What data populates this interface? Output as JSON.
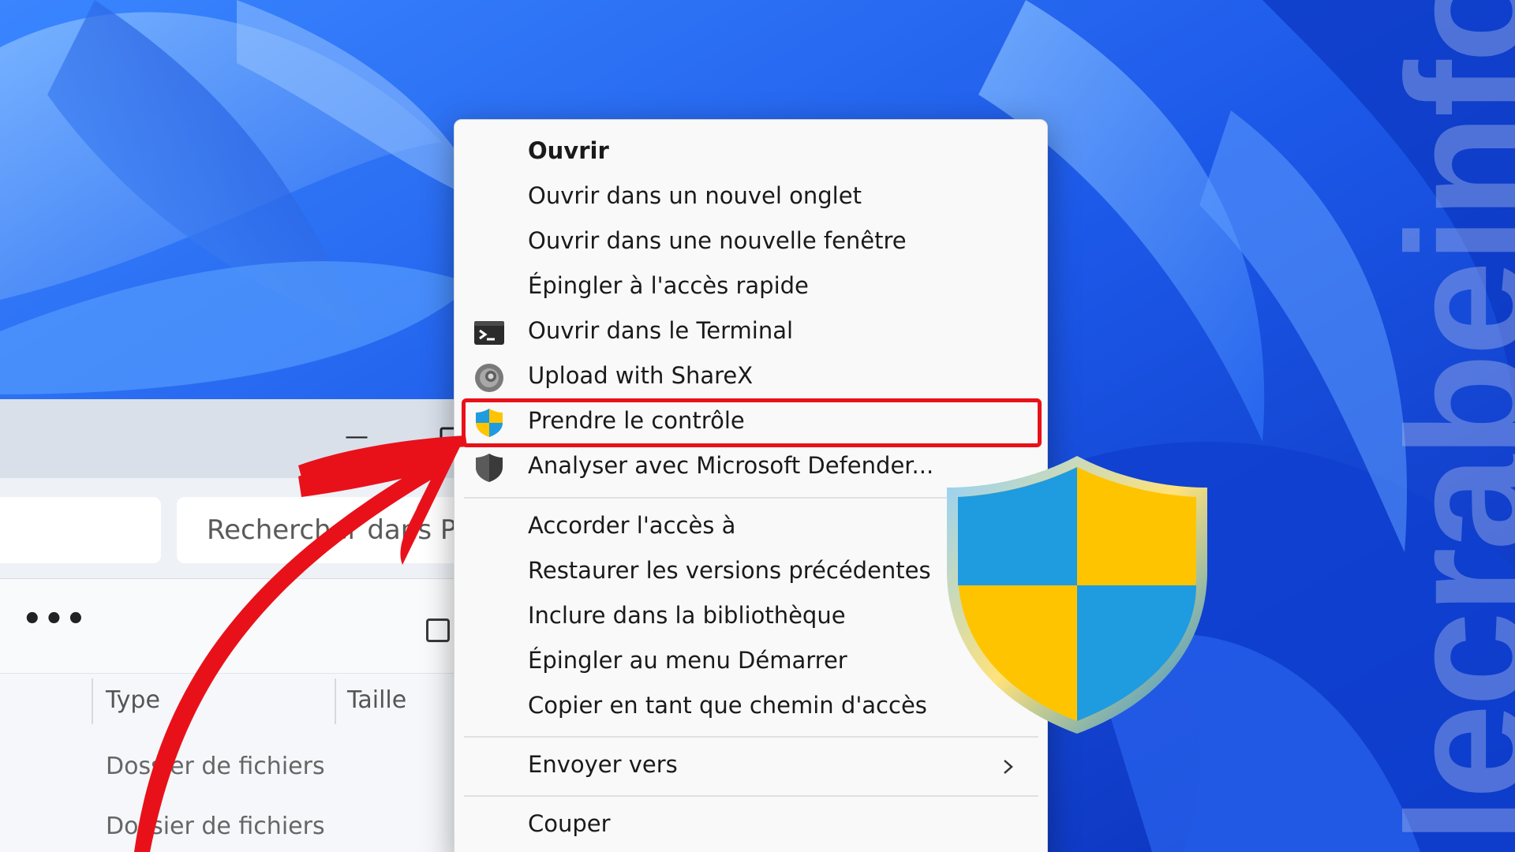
{
  "explorer": {
    "search_placeholder": "Rechercher dans Pr",
    "more_label": "•••",
    "minimize_glyph": "—",
    "columns": {
      "type": "Type",
      "size": "Taille"
    },
    "rows": [
      {
        "type": "Dossier de fichiers"
      },
      {
        "type": "Dossier de fichiers"
      }
    ]
  },
  "context_menu": {
    "items": [
      {
        "label": "Ouvrir",
        "bold": true
      },
      {
        "label": "Ouvrir dans un nouvel onglet"
      },
      {
        "label": "Ouvrir dans une nouvelle fenêtre"
      },
      {
        "label": "Épingler à l'accès rapide"
      },
      {
        "label": "Ouvrir dans le Terminal",
        "icon": "terminal-icon"
      },
      {
        "label": "Upload with ShareX",
        "icon": "sharex-icon"
      },
      {
        "label": "Prendre le contrôle",
        "icon": "uac-shield-icon",
        "highlighted": true
      },
      {
        "label": "Analyser avec Microsoft Defender...",
        "icon": "defender-shield-icon"
      },
      {
        "label": "Accorder l'accès à"
      },
      {
        "label": "Restaurer les versions précédentes"
      },
      {
        "label": "Inclure dans la bibliothèque"
      },
      {
        "label": "Épingler au menu Démarrer"
      },
      {
        "label": "Copier en tant que chemin d'accès"
      },
      {
        "label": "Envoyer vers",
        "submenu": true
      },
      {
        "label": "Couper"
      }
    ]
  },
  "watermark": "lecrabeinfo",
  "colors": {
    "highlight_border": "#e8111a",
    "arrow": "#e8111a",
    "shield_blue": "#1f9be0",
    "shield_yellow": "#ffc400"
  }
}
